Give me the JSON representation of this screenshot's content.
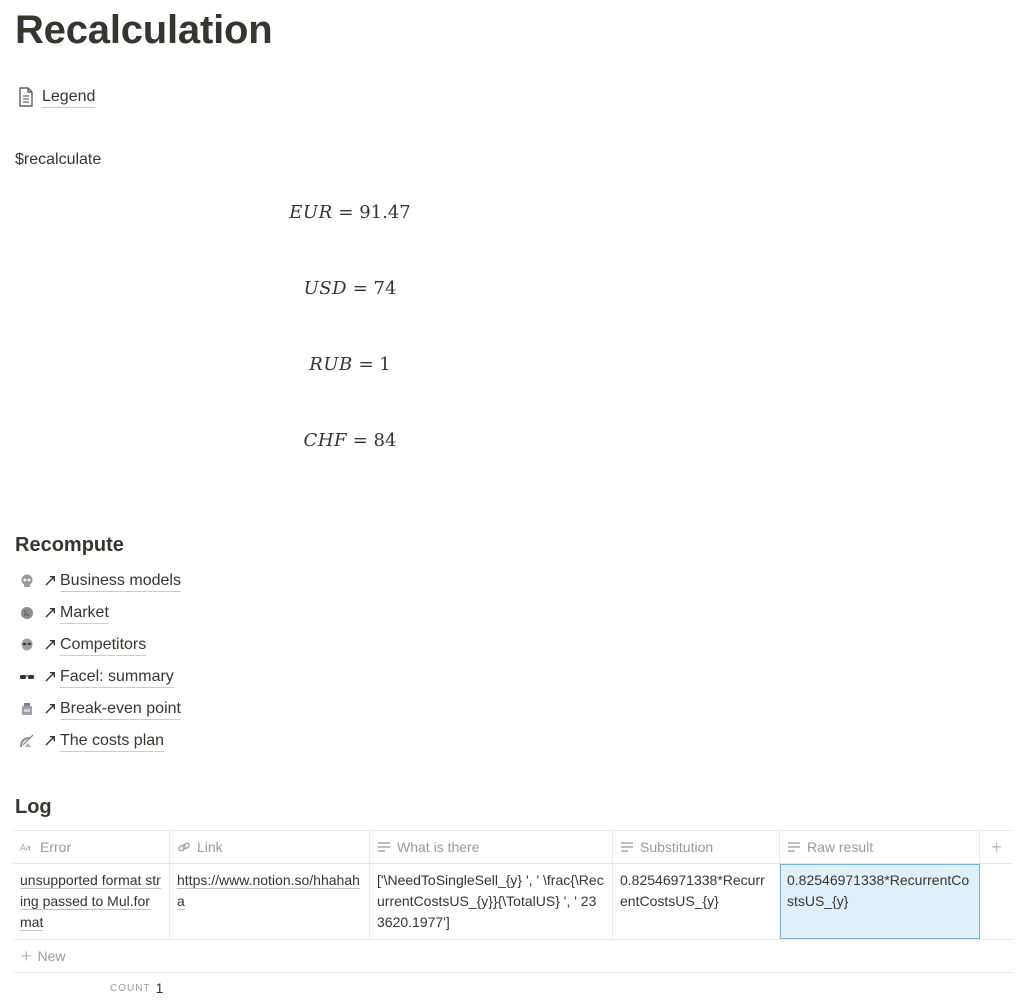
{
  "page": {
    "title": "Recalculation",
    "legend_link": "Legend",
    "command": "$recalculate"
  },
  "equations": [
    {
      "var": "EUR",
      "value": "91.47"
    },
    {
      "var": "USD",
      "value": "74"
    },
    {
      "var": "RUB",
      "value": "1"
    },
    {
      "var": "CHF",
      "value": "84"
    }
  ],
  "recompute": {
    "heading": "Recompute",
    "items": [
      {
        "emoji_icon": "skull-icon",
        "label": "Business models"
      },
      {
        "emoji_icon": "globe-icon",
        "label": "Market"
      },
      {
        "emoji_icon": "alien-icon",
        "label": "Competitors"
      },
      {
        "emoji_icon": "sunglasses-icon",
        "label": "Facel: summary"
      },
      {
        "emoji_icon": "robot-icon",
        "label": "Break-even point"
      },
      {
        "emoji_icon": "satellite-dish-icon",
        "label": "The costs plan"
      }
    ]
  },
  "log": {
    "heading": "Log",
    "columns": [
      "Error",
      "Link",
      "What is there",
      "Substitution",
      "Raw result"
    ],
    "rows": [
      {
        "error": "unsupported format string passed to Mul.format",
        "link": "https://www.notion.so/hhahaha",
        "what_is_there": "['\\NeedToSingleSell_{y} ', ' \\frac{\\RecurrentCostsUS_{y}}{\\TotalUS} ', ' 233620.1977']",
        "substitution": "0.82546971338*RecurrentCostsUS_{y}",
        "raw_result": "0.82546971338*RecurrentCostsUS_{y}"
      }
    ],
    "new_label": "New",
    "count_label": "COUNT",
    "count_value": "1"
  }
}
